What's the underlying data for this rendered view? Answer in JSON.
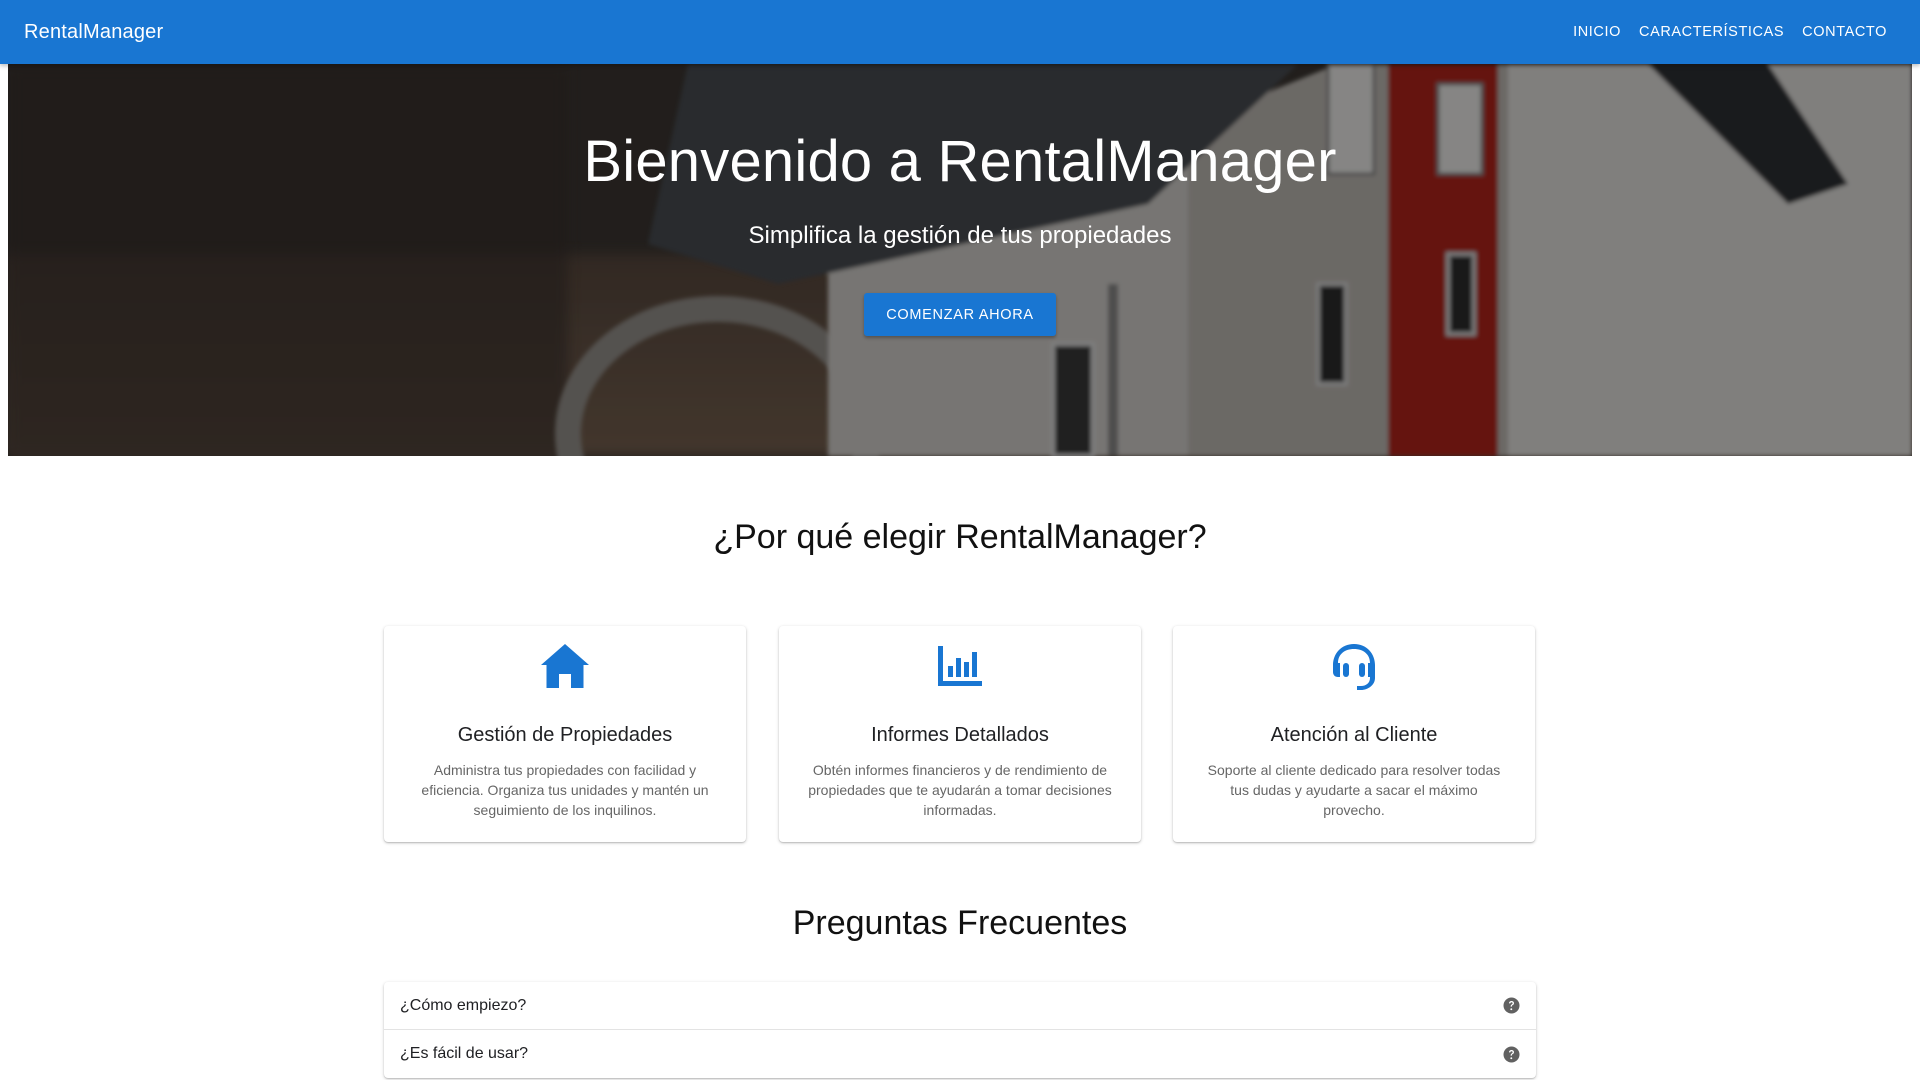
{
  "appbar": {
    "brand": "RentalManager",
    "nav": [
      "INICIO",
      "CARACTERÍSTICAS",
      "CONTACTO"
    ],
    "color": "#1976d2"
  },
  "hero": {
    "title": "Bienvenido a RentalManager",
    "subtitle": "Simplifica la gestión de tus propiedades",
    "cta_label": "COMENZAR AHORA"
  },
  "features": {
    "title": "¿Por qué elegir RentalManager?",
    "cards": [
      {
        "icon": "home-icon",
        "title": "Gestión de Propiedades",
        "text": "Administra tus propiedades con facilidad y eficiencia. Organiza tus unidades y mantén un seguimiento de los inquilinos."
      },
      {
        "icon": "chart-icon",
        "title": "Informes Detallados",
        "text": "Obtén informes financieros y de rendimiento de propiedades que te ayudarán a tomar decisiones informadas."
      },
      {
        "icon": "headset-icon",
        "title": "Atención al Cliente",
        "text": "Soporte al cliente dedicado para resolver todas tus dudas y ayudarte a sacar el máximo provecho."
      }
    ]
  },
  "faq": {
    "title": "Preguntas Frecuentes",
    "items": [
      "¿Cómo empiezo?",
      "¿Es fácil de usar?"
    ]
  }
}
